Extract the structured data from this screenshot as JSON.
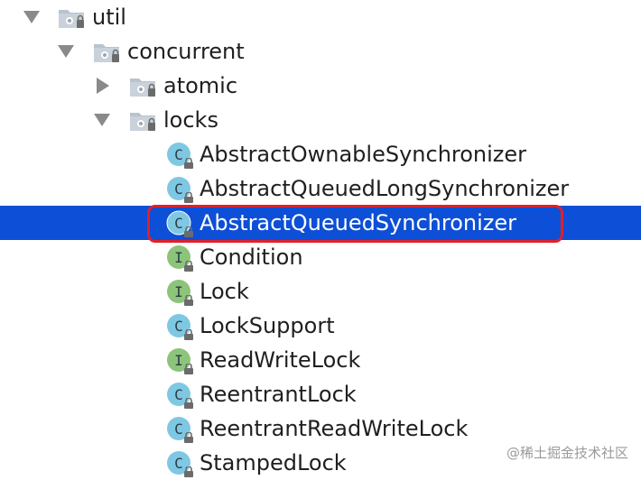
{
  "tree": {
    "folders": {
      "util": "util",
      "concurrent": "concurrent",
      "atomic": "atomic",
      "locks": "locks"
    },
    "items": [
      {
        "label": "AbstractOwnableSynchronizer",
        "kind": "class",
        "icon_letter": "C"
      },
      {
        "label": "AbstractQueuedLongSynchronizer",
        "kind": "class",
        "icon_letter": "C"
      },
      {
        "label": "AbstractQueuedSynchronizer",
        "kind": "class",
        "icon_letter": "C",
        "selected": true
      },
      {
        "label": "Condition",
        "kind": "interface",
        "icon_letter": "I"
      },
      {
        "label": "Lock",
        "kind": "interface",
        "icon_letter": "I"
      },
      {
        "label": "LockSupport",
        "kind": "class",
        "icon_letter": "C"
      },
      {
        "label": "ReadWriteLock",
        "kind": "interface",
        "icon_letter": "I"
      },
      {
        "label": "ReentrantLock",
        "kind": "class",
        "icon_letter": "C"
      },
      {
        "label": "ReentrantReadWriteLock",
        "kind": "class",
        "icon_letter": "C"
      },
      {
        "label": "StampedLock",
        "kind": "class",
        "icon_letter": "C"
      }
    ]
  },
  "colors": {
    "selection": "#0d4fd6",
    "highlight_border": "#e0202a",
    "class_icon": "#7ec8e3",
    "interface_icon": "#8cc47a"
  },
  "icons": {
    "expanded": "triangle-down-icon",
    "collapsed": "triangle-right-icon",
    "package": "package-folder-icon",
    "class": "class-icon",
    "interface": "interface-icon"
  },
  "watermark": "@稀土掘金技术社区"
}
